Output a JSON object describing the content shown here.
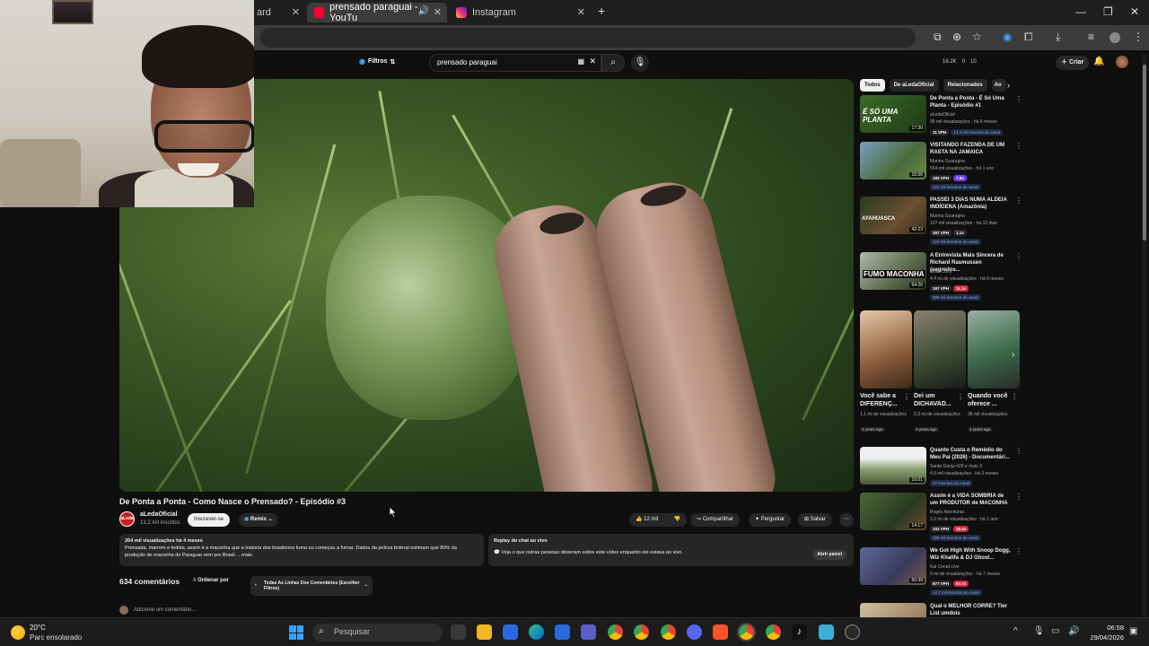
{
  "browser": {
    "tabs": [
      {
        "label": "ard"
      },
      {
        "label": "prensado paraguai - YouTu"
      },
      {
        "label": "Instagram"
      }
    ],
    "new_tab": "+",
    "window_controls": {
      "minimize": "—",
      "restore": "❐",
      "close": "✕"
    }
  },
  "youtube": {
    "filters_label": "Filtros",
    "search_value": "prensado paraguai",
    "stats": [
      "16.2K",
      "0",
      "10"
    ],
    "criar_label": "Criar",
    "video": {
      "title": "De Ponta a Ponta - Como Nasce o Prensado? - Episódio #3",
      "channel": "aLedaOficial",
      "subscribers": "13,2 mil inscritos",
      "subscribe_label": "Inscrever-se",
      "remix_label": "Remix",
      "likes": "12 mil",
      "share_label": "Compartilhar",
      "ask_label": "Perguntar",
      "save_label": "Salvar",
      "description_meta": "264 mil visualizações  há 4 meses",
      "description_text": "Prensada, marrom e fedida, assim é a maconha que a maioria dos brasileiros fuma ou começou a fumar. Dados da polícia federal estimam que 80% da produção de maconha do Paraguai vem pro Brasil.  ...mais"
    },
    "chat_replay": {
      "title": "Replay do chat ao vivo",
      "text": "Veja o que outras pessoas disseram sobre este vídeo enquanto ele estava ao vivo.",
      "open_label": "Abrir painel"
    },
    "comments": {
      "count_label": "634 comentários",
      "order_label": "Ordenar por",
      "lines_label": "Todas As Linhas Dos Comentários (Escolher Filtros)",
      "add_placeholder": "Adicione um comentário..."
    },
    "sidebar": {
      "chips": [
        "Todos",
        "De aLedaOficial",
        "Relacionados",
        "Ao"
      ],
      "recommendations": [
        {
          "title": "De Ponta a Ponta - É Só Uma Planta - Episódio #1",
          "channel": "aLedaOficial",
          "meta": "95 mil visualizações · há 6 meses",
          "duration": "17:30",
          "vph": "11 VPH",
          "subs": "13,2 mil inscritos do canal",
          "thumb_text": "É SÓ UMA PLANTA"
        },
        {
          "title": "VISITANDO FAZENDA DE UM RASTA NA JAMAICA",
          "channel": "Marina Guaragna",
          "meta": "554 mil visualizações · há 1 ano",
          "duration": "15:56",
          "vph": "183 VPH",
          "mult": "7.8x",
          "subs": "422 mil inscritos do canal"
        },
        {
          "title": "PASSEI 3 DIAS NUMA ALDEIA INDÍGENA (Amazônia)",
          "channel": "Marina Guaragna",
          "meta": "127 mil visualizações · há 12 dias",
          "duration": "42:23",
          "vph": "267 VPH",
          "mult": "1.1x",
          "subs": "422 mil inscritos do canal",
          "thumb_text": "AYAHUASCA"
        },
        {
          "title": "A Entrevista Mais Sincera de Richard Rasmussen (segredos...",
          "channel": "Joao Curry",
          "meta": "4,4 mi de visualizações · há 6 meses",
          "duration": "54:26",
          "vph": "197 VPH",
          "mult": "11.1x",
          "subs": "908 mil inscritos do canal",
          "thumb_text": "FUMO MACONHA"
        }
      ],
      "shorts": [
        {
          "title": "Você sabe a DIFERENÇ...",
          "views": "1,1 mi de visualizações",
          "date": "3 years ago"
        },
        {
          "title": "Dei um DICHAVAD...",
          "views": "2,3 mi de visualizações",
          "date": "3 years ago"
        },
        {
          "title": "Quando você oferece ...",
          "views": "36 mil visualizações",
          "date": "2 years ago"
        }
      ],
      "recommendations2": [
        {
          "title": "Quanto Custa o Remédio do Meu Pai (2026) - Documentári...",
          "channel": "Santa Ganja 420 e mais 3",
          "meta": "4,5 mil visualizações · há 3 meses",
          "duration": "16:01",
          "subs": "27 inscritos do canal"
        },
        {
          "title": "Assim é a VIDA SOMBRIA de um PRODUTOR de MACONHA",
          "channel": "Rogés Aventuras",
          "meta": "3,2 mi de visualizações · há 1 ano",
          "duration": "14:17",
          "vph": "102 VPH",
          "mult": "15.4x",
          "subs": "208 mil inscritos do canal"
        },
        {
          "title": "We Got High With Snoop Dogg, Wiz Khalifa & DJ Ghost...",
          "channel": "Kai Cenat Live",
          "meta": "9 mi de visualizações · há 7 meses",
          "duration": "50:39",
          "vph": "677 VPH",
          "mult": "53.7x",
          "subs": "14,7 mil inscritos do canal"
        },
        {
          "title": "Qual o MELHOR CORRE? Tier List umdois",
          "channel": "",
          "meta": "",
          "duration": ""
        }
      ]
    }
  },
  "taskbar": {
    "temperature": "20°C",
    "condition": "Parc ensolarado",
    "search_placeholder": "Pesquisar",
    "time": "06:58",
    "date": "29/04/2026"
  },
  "colors": {
    "yt_red": "#ff0033",
    "accent_blue": "#3ea6ff",
    "bg": "#0f0f0f"
  }
}
